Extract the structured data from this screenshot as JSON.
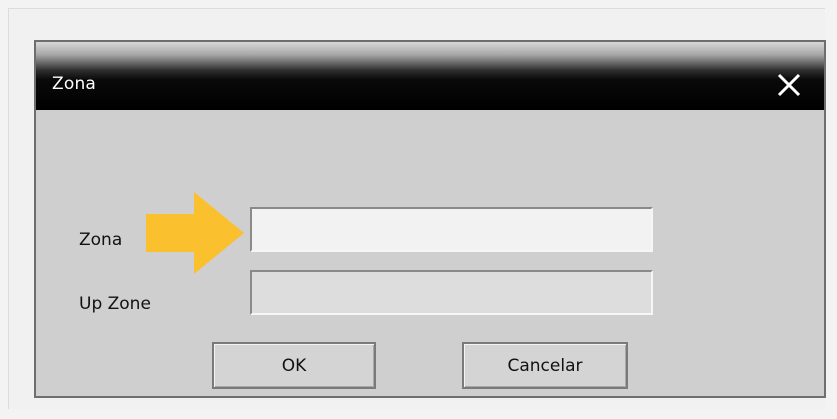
{
  "window": {
    "title": "Zona",
    "close_icon": "close-icon"
  },
  "form": {
    "zona_label": "Zona",
    "zona_value": "",
    "upzone_label": "Up Zone",
    "upzone_value": ""
  },
  "buttons": {
    "ok_label": "OK",
    "cancel_label": "Cancelar"
  },
  "annotation": {
    "arrow_color": "#FBC02D",
    "arrow_icon": "arrow-right-icon"
  }
}
